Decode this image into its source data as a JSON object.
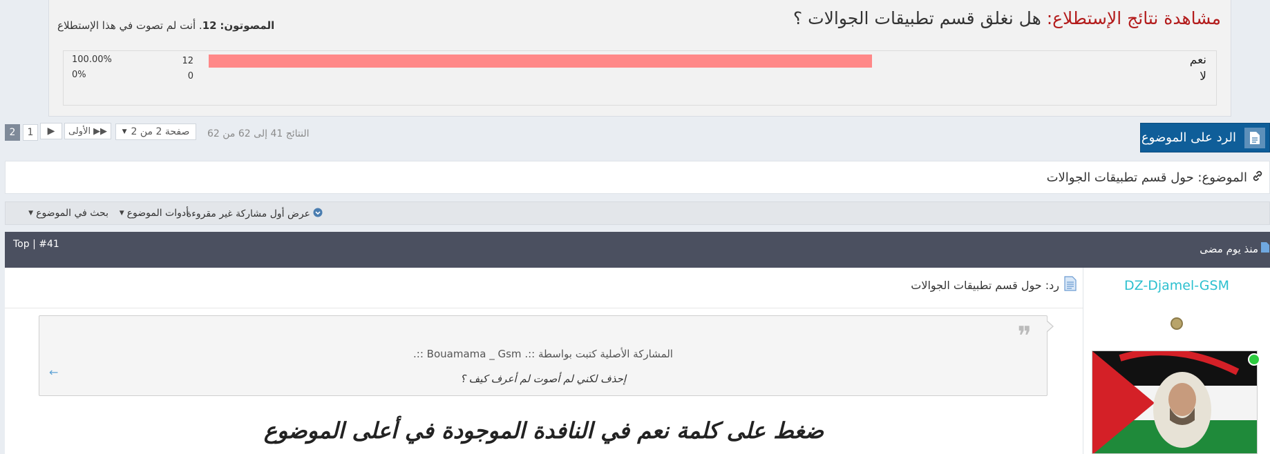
{
  "poll": {
    "title_prefix": "مشاهدة نتائج الإستطلاع:",
    "question": " هل نغلق قسم تطبيقات الجوالات ؟",
    "voters_label": "المصوتون:",
    "voters_count": "12",
    "voters_note": ". أنت لم تصوت في هذا الإستطلاع",
    "options": [
      {
        "label": "نعم",
        "count": "12",
        "percent": "100.00%",
        "fraction": 1.0
      },
      {
        "label": "لا",
        "count": "0",
        "percent": "0%",
        "fraction": 0.0
      }
    ]
  },
  "pagination": {
    "current": "2",
    "page_1": "1",
    "first": "الأولى",
    "page_select": "صفحة 2 من 2",
    "results": "النتائج 41 إلى 62 من 62"
  },
  "reply_button": "الرد على الموضوع",
  "topic_title": "الموضوع: حول قسم تطبيقات الجوالات",
  "tools": {
    "first_unread": "عرض أول مشاركة غير مقروءة",
    "thread_tools": "أدوات الموضوع",
    "search_thread": "بحث في الموضوع"
  },
  "post": {
    "date": "منذ يوم مضى",
    "number": "Top | #41",
    "title": "رد: حول قسم تطبيقات الجوالات",
    "quote_author": "المشاركة الأصلية كتبت بواسطة ::. Bouamama _ Gsm ::.",
    "quote_text": "إحذف لكني لم أصوت لم أعرف كيف ؟",
    "message": "ضغط على كلمة نعم في النافدة الموجودة في أعلى الموضوع",
    "username": "DZ-Djamel-GSM"
  },
  "colors": {
    "poll_bar": "#ff8888",
    "reply_button": "#0f5e99",
    "post_header": "#4b5060",
    "username": "#2cc0cf",
    "poll_title_prefix": "#b31c1c"
  },
  "icons": {
    "reply": "document-icon",
    "topic": "link-icon",
    "post": "document-icon",
    "quote": "quote-mark-icon",
    "online": "online-status-icon"
  }
}
